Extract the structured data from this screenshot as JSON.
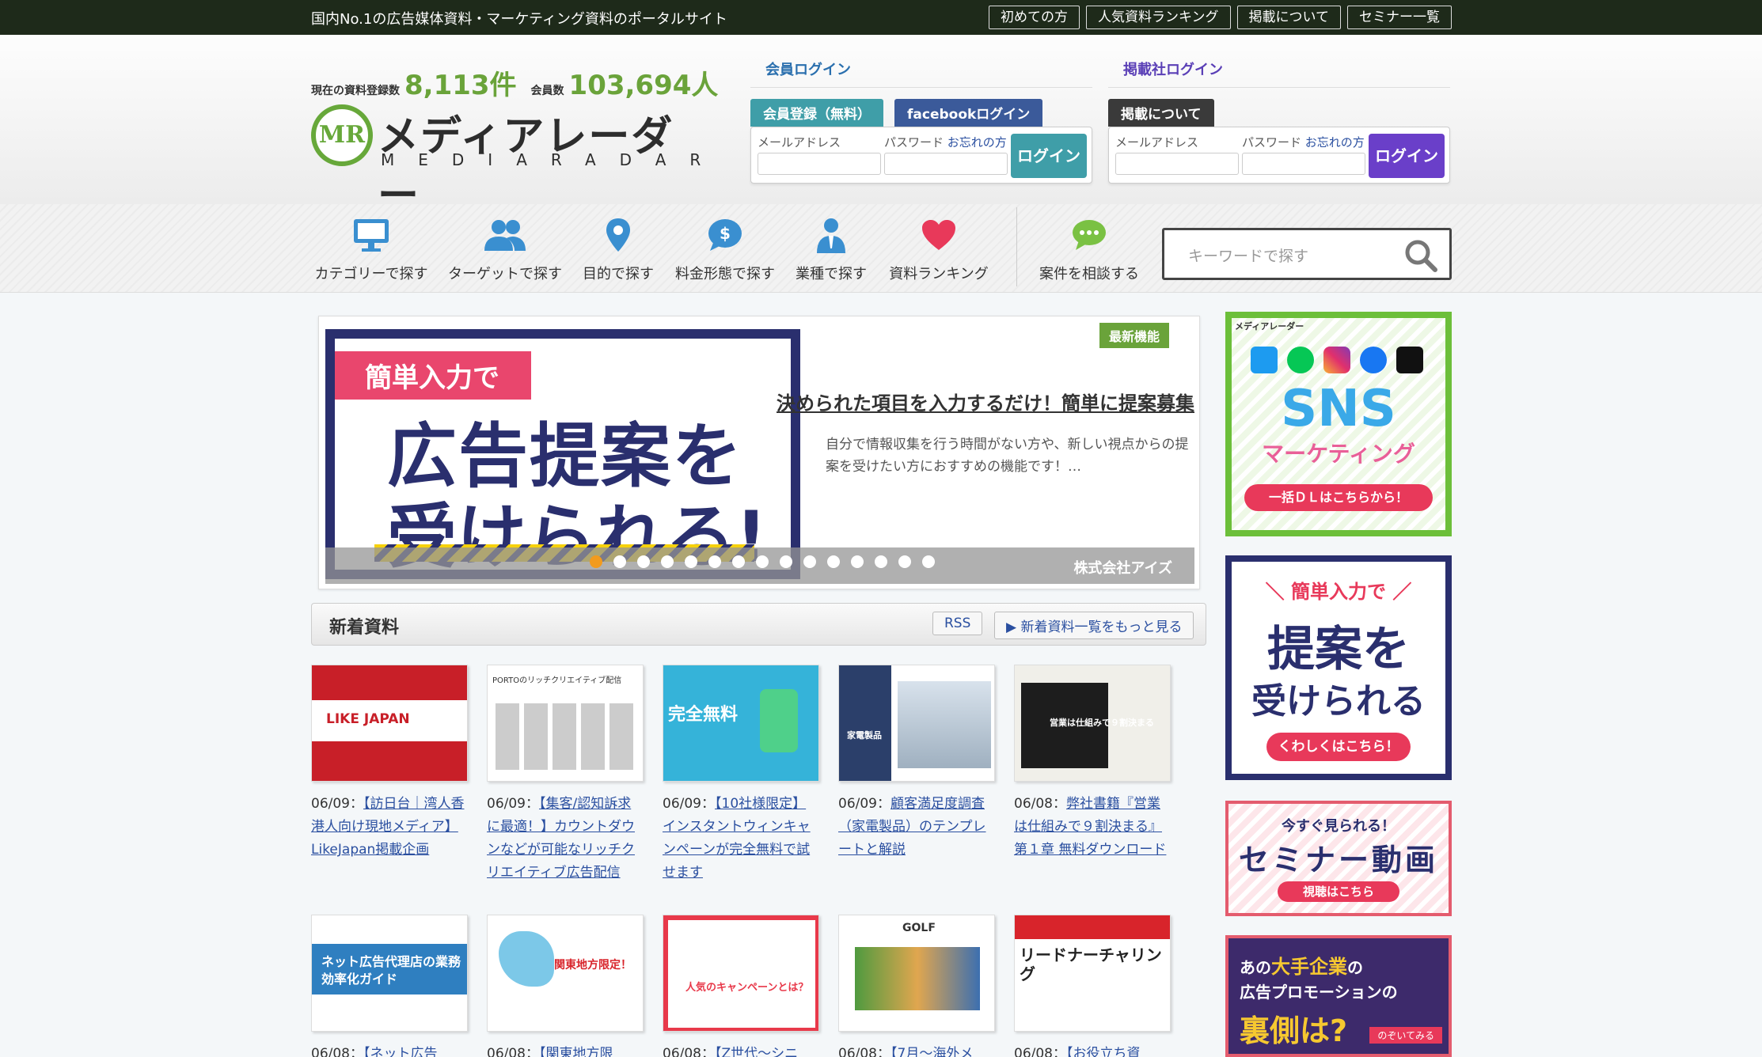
{
  "topbar": {
    "tagline": "国内No.1の広告媒体資料・マーケティング資料のポータルサイト",
    "links": [
      "初めての方",
      "人気資料ランキング",
      "掲載について",
      "セミナー一覧"
    ]
  },
  "stats": {
    "docs_label": "現在の資料登録数",
    "docs_count": "8,113件",
    "members_label": "会員数",
    "members_count": "103,694人"
  },
  "logo": {
    "jp": "メディアレーダー",
    "en": "MEDIARADAR",
    "mark": "MR"
  },
  "member_login": {
    "title": "会員ログイン",
    "register_tab": "会員登録（無料）",
    "facebook_tab": "facebookログイン",
    "email_label": "メールアドレス",
    "password_label": "パスワード",
    "forgot_link": "お忘れの方",
    "login_button": "ログイン",
    "color": "#3f9ea8"
  },
  "publisher_login": {
    "title": "掲載社ログイン",
    "about_tab": "掲載について",
    "email_label": "メールアドレス",
    "password_label": "パスワード",
    "forgot_link": "お忘れの方",
    "login_button": "ログイン",
    "color": "#6a3fc9"
  },
  "nav": {
    "items": [
      {
        "label": "カテゴリーで探す",
        "icon": "monitor-icon"
      },
      {
        "label": "ターゲットで探す",
        "icon": "people-icon"
      },
      {
        "label": "目的で探す",
        "icon": "map-pin-icon"
      },
      {
        "label": "料金形態で探す",
        "icon": "price-bubble-icon"
      },
      {
        "label": "業種で探す",
        "icon": "businessman-icon"
      },
      {
        "label": "資料ランキング",
        "icon": "heart-icon"
      },
      {
        "label": "案件を相談する",
        "icon": "chat-icon"
      }
    ],
    "search_placeholder": "キーワードで探す"
  },
  "carousel": {
    "badge": "最新機能",
    "image_tag": "簡単入力で",
    "image_line1": "広告提案を",
    "image_line2": "受けられる!",
    "title": "決められた項目を入力するだけ！簡単に提案募集",
    "description": "自分で情報収集を行う時間がない方や、新しい視点からの提案を受けたい方におすすめの機能です！…",
    "company": "株式会社アイズ",
    "dot_count": 15,
    "active_dot": 0
  },
  "new_docs": {
    "title": "新着資料",
    "rss": "RSS",
    "more": "▶ 新着資料一覧をもっと見る",
    "items": [
      {
        "date": "06/09：",
        "title": "【訪日台｜湾人香港人向け現地メディア】LikeJapan掲載企画",
        "thumb": "LIKE JAPAN"
      },
      {
        "date": "06/09：",
        "title": "【集客/認知訴求に最適！】カウントダウンなどが可能なリッチクリエイティブ広告配信",
        "thumb": "PORTOのリッチクリエイティブ配信"
      },
      {
        "date": "06/09：",
        "title": "【10社様限定】インスタントウィンキャンペーンが完全無料で試せます",
        "thumb": "完全無料"
      },
      {
        "date": "06/09：",
        "title": "顧客満足度調査（家電製品）のテンプレートと解説",
        "thumb": "家電製品"
      },
      {
        "date": "06/08：",
        "title": "弊社書籍『営業は仕組みで９割決まる』第１章 無料ダウンロード",
        "thumb": "営業は仕組みで９割決まる"
      },
      {
        "date": "06/08：",
        "title": "【ネット広告",
        "thumb": "ネット広告代理店の業務効率化ガイド"
      },
      {
        "date": "06/08：",
        "title": "【関東地方限",
        "thumb": "関東地方限定！"
      },
      {
        "date": "06/08：",
        "title": "【Z世代〜シニ",
        "thumb": "人気のキャンペーンとは？"
      },
      {
        "date": "06/08：",
        "title": "【7月〜海外メ",
        "thumb": "GOLF"
      },
      {
        "date": "06/08：",
        "title": "【お役立ち資",
        "thumb": "リードナーチャリング"
      }
    ]
  },
  "banners": {
    "sns_brand": "メディアレーダー",
    "sns_title": "SNS",
    "sns_sub": "マーケティング",
    "sns_cta": "一括ＤＬはこちらから！",
    "proposal_tag": "＼ 簡単入力で ／",
    "proposal_line1": "提案を",
    "proposal_line2": "受けられる",
    "proposal_cta": "くわしくはこちら！",
    "seminar_top": "今すぐ見られる！",
    "seminar_title": "セミナー動画",
    "seminar_cta": "視聴はこちら",
    "promo_line1a": "あの",
    "promo_line1b": "大手企業",
    "promo_line1c": "の",
    "promo_line2": "広告プロモーションの",
    "promo_line3": "裏側は?",
    "promo_cta": "のぞいてみる"
  }
}
